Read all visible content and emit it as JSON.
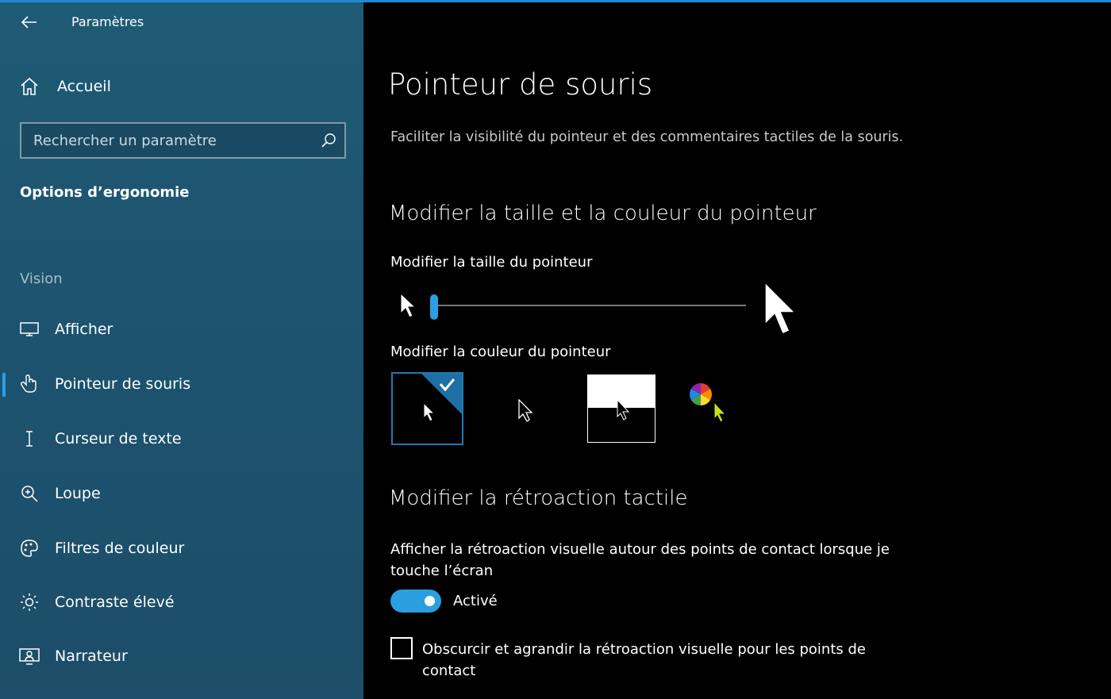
{
  "accent": "#2b9ee0",
  "sidebar": {
    "app_title": "Paramètres",
    "home_label": "Accueil",
    "search_placeholder": "Rechercher un paramètre",
    "section_title": "Options d’ergonomie",
    "group_label": "Vision",
    "items": [
      {
        "label": "Afficher",
        "icon": "monitor-icon"
      },
      {
        "label": "Pointeur de souris",
        "icon": "hand-pointer-icon",
        "active": true
      },
      {
        "label": "Curseur de texte",
        "icon": "text-cursor-icon"
      },
      {
        "label": "Loupe",
        "icon": "magnifier-icon"
      },
      {
        "label": "Filtres de couleur",
        "icon": "palette-icon"
      },
      {
        "label": "Contraste élevé",
        "icon": "brightness-icon"
      },
      {
        "label": "Narrateur",
        "icon": "narrator-icon"
      }
    ]
  },
  "main": {
    "title": "Pointeur de souris",
    "description": "Faciliter la visibilité du pointeur et des commentaires tactiles de la souris.",
    "size_color_heading": "Modifier la taille et la couleur du pointeur",
    "size_label": "Modifier la taille du pointeur",
    "size_value": 1,
    "color_label": "Modifier la couleur du pointeur",
    "color_options": [
      "white",
      "black",
      "inverted",
      "custom"
    ],
    "selected_color_option": "white",
    "touch_heading": "Modifier la rétroaction tactile",
    "touch_label": "Afficher la rétroaction visuelle autour des points de contact lorsque je touche l’écran",
    "toggle_state": "Activé",
    "checkbox_label": "Obscurcir et agrandir la rétroaction visuelle pour les points de contact",
    "checkbox_checked": false
  }
}
